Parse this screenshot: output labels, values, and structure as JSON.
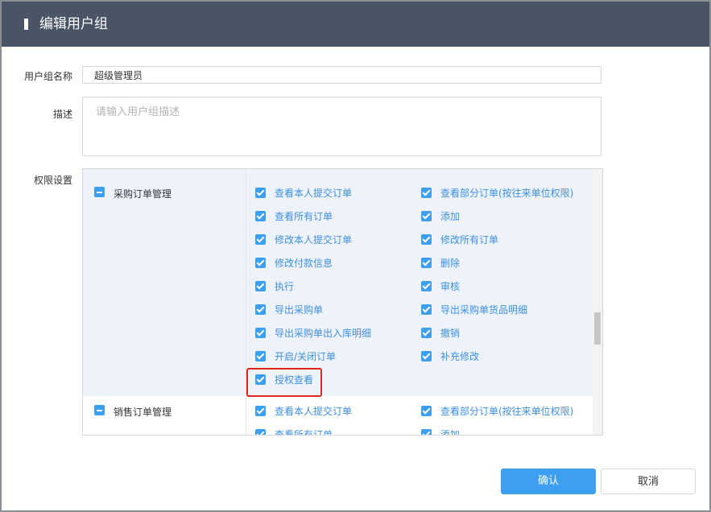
{
  "dialog": {
    "title": "编辑用户组"
  },
  "form": {
    "name_label": "用户组名称",
    "name_value": "超级管理员",
    "desc_label": "描述",
    "desc_placeholder": "请输入用户组描述",
    "perm_label": "权限设置"
  },
  "permissions": [
    {
      "category": "采购订单管理",
      "items": [
        "查看本人提交订单",
        "查看部分订单(按往来单位权限)",
        "查看所有订单",
        "添加",
        "修改本人提交订单",
        "修改所有订单",
        "修改付款信息",
        "删除",
        "执行",
        "审核",
        "导出采购单",
        "导出采购单货品明细",
        "导出采购单出入库明细",
        "撤销",
        "开启/关闭订单",
        "补充修改",
        "授权查看"
      ]
    },
    {
      "category": "销售订单管理",
      "items": [
        "查看本人提交订单",
        "查看部分订单(按往来单位权限)",
        "查看所有订单",
        "添加"
      ]
    }
  ],
  "buttons": {
    "confirm": "确认",
    "cancel": "取消"
  },
  "colors": {
    "header": "#495466",
    "accent": "#3d9ff2",
    "highlight": "#e0261a"
  }
}
